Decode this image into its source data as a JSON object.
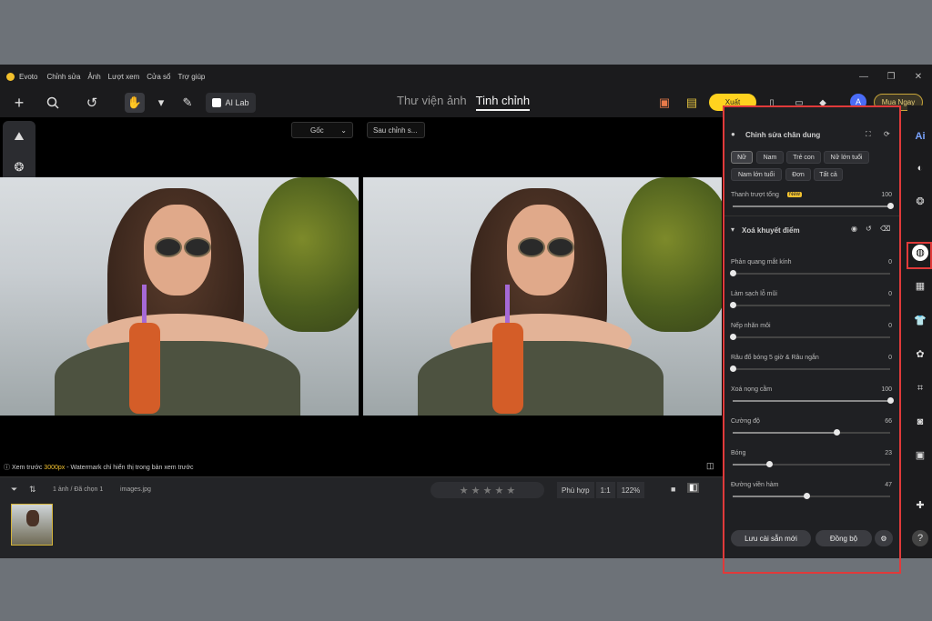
{
  "app": {
    "title": "Evoto"
  },
  "menu": [
    "Chỉnh sửa",
    "Ảnh",
    "Lượt xem",
    "Cửa sổ",
    "Trợ giúp"
  ],
  "window_controls": [
    "—",
    "❐",
    "✕"
  ],
  "toolbar": {
    "add": "+",
    "search_icon": "search-icon",
    "undo": "↺",
    "ai_lab": "AI Lab",
    "nav_library": "Thư viện ảnh",
    "nav_refine": "Tinh chỉnh",
    "export": "Xuất",
    "avatar_letter": "A",
    "buy": "Mua Ngay"
  },
  "canvas": {
    "before_select": "Gốc",
    "after_select": "Sau chỉnh s...",
    "info_prefix": "Xem trước ",
    "info_highlight": "3000px",
    "info_suffix": " - Watermark chỉ hiển thị trong bản xem trước"
  },
  "filmstrip": {
    "count": "1 ảnh / Đã chọn 1",
    "filename": "images.jpg",
    "stars": "★ ★ ★ ★ ★",
    "fit": "Phù hợp",
    "one_to_one": "1:1",
    "zoom": "122%"
  },
  "panel": {
    "title": "Chỉnh sửa chân dung",
    "chips": [
      "Nữ",
      "Nam",
      "Trẻ con",
      "Nữ lớn tuổi",
      "Nam lớn tuổi",
      "Đơn",
      "Tất cả"
    ],
    "master_label": "Thanh trượt tổng",
    "master_badge": "New",
    "master_value": 100,
    "section_title": "Xoá khuyết điểm",
    "sliders": [
      {
        "label": "Phản quang mắt kính",
        "value": 0
      },
      {
        "label": "Làm sạch lỗ mũi",
        "value": 0
      },
      {
        "label": "Nếp nhăn môi",
        "value": 0
      },
      {
        "label": "Râu đổ bóng 5 giờ & Râu ngắn",
        "value": 0
      },
      {
        "label": "Xoá nọng cằm",
        "value": 100
      },
      {
        "label": "Cường độ",
        "value": 66
      },
      {
        "label": "Bóng",
        "value": 23
      },
      {
        "label": "Đường viền hàm",
        "value": 47
      }
    ],
    "save_preset": "Lưu cài sẵn mới",
    "sync": "Đồng bộ"
  },
  "colors": {
    "accent": "#ffd21f",
    "highlight_box": "#e03a3a",
    "bg": "#1b1b1d"
  }
}
